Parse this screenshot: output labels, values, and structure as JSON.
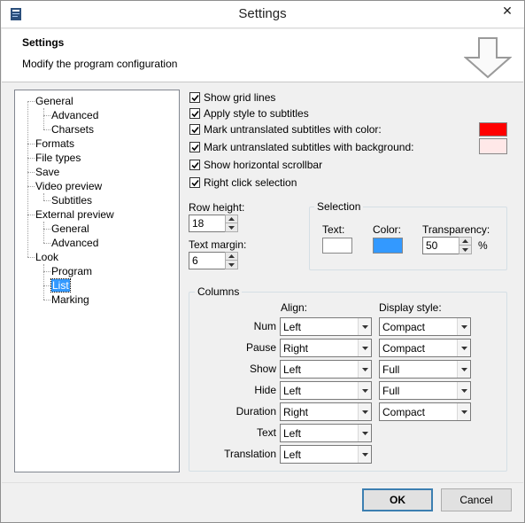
{
  "window": {
    "title": "Settings",
    "close_glyph": "✕",
    "icon": "app-icon"
  },
  "header": {
    "title": "Settings",
    "subtitle": "Modify the program configuration",
    "arrow_icon": "down-arrow-icon"
  },
  "tree": {
    "items": [
      {
        "label": "General"
      },
      {
        "label": "Advanced"
      },
      {
        "label": "Charsets"
      },
      {
        "label": "Formats"
      },
      {
        "label": "File types"
      },
      {
        "label": "Save"
      },
      {
        "label": "Video preview"
      },
      {
        "label": "Subtitles"
      },
      {
        "label": "External preview"
      },
      {
        "label": "General"
      },
      {
        "label": "Advanced"
      },
      {
        "label": "Look"
      },
      {
        "label": "Program"
      },
      {
        "label": "List",
        "selected": true
      },
      {
        "label": "Marking"
      }
    ]
  },
  "options": {
    "show_grid_lines": {
      "label": "Show grid lines",
      "checked": true
    },
    "apply_style": {
      "label": "Apply style to subtitles",
      "checked": true
    },
    "mark_color": {
      "label": "Mark untranslated subtitles with color:",
      "checked": true,
      "color": "#ff0000"
    },
    "mark_background": {
      "label": "Mark untranslated subtitles with background:",
      "checked": true,
      "color": "#ffe8e8"
    },
    "horizontal_scrollbar": {
      "label": "Show horizontal scrollbar",
      "checked": true
    },
    "right_click": {
      "label": "Right click selection",
      "checked": true
    }
  },
  "row_height": {
    "label": "Row height:",
    "value": "18"
  },
  "text_margin": {
    "label": "Text margin:",
    "value": "6"
  },
  "selection": {
    "title": "Selection",
    "text_label": "Text:",
    "text_color": "#ffffff",
    "color_label": "Color:",
    "color_value": "#3399ff",
    "transparency_label": "Transparency:",
    "transparency_value": "50",
    "percent": "%"
  },
  "columns": {
    "title": "Columns",
    "align_header": "Align:",
    "display_header": "Display style:",
    "rows": [
      {
        "name": "Num",
        "align": "Left",
        "style": "Compact"
      },
      {
        "name": "Pause",
        "align": "Right",
        "style": "Compact"
      },
      {
        "name": "Show",
        "align": "Left",
        "style": "Full"
      },
      {
        "name": "Hide",
        "align": "Left",
        "style": "Full"
      },
      {
        "name": "Duration",
        "align": "Right",
        "style": "Compact"
      },
      {
        "name": "Text",
        "align": "Left",
        "style": null
      },
      {
        "name": "Translation",
        "align": "Left",
        "style": null
      }
    ]
  },
  "buttons": {
    "ok": "OK",
    "cancel": "Cancel"
  }
}
